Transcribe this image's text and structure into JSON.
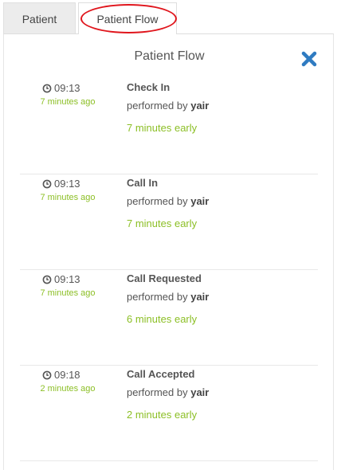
{
  "tabs": [
    {
      "label": "Patient",
      "active": false
    },
    {
      "label": "Patient Flow",
      "active": true
    }
  ],
  "panel": {
    "title": "Patient Flow",
    "close_icon": "close-icon",
    "accent_color": "#8cbf26",
    "close_color": "#2f7bc1",
    "highlight_color": "#e0161d"
  },
  "entries": [
    {
      "time": "09:13",
      "ago": "7 minutes ago",
      "action": "Check In",
      "performed_prefix": "performed by",
      "performer": "yair",
      "early": "7 minutes early"
    },
    {
      "time": "09:13",
      "ago": "7 minutes ago",
      "action": "Call In",
      "performed_prefix": "performed by",
      "performer": "yair",
      "early": "7 minutes early"
    },
    {
      "time": "09:13",
      "ago": "7 minutes ago",
      "action": "Call Requested",
      "performed_prefix": "performed by",
      "performer": "yair",
      "early": "6 minutes early"
    },
    {
      "time": "09:18",
      "ago": "2 minutes ago",
      "action": "Call Accepted",
      "performed_prefix": "performed by",
      "performer": "yair",
      "early": "2 minutes early"
    }
  ]
}
